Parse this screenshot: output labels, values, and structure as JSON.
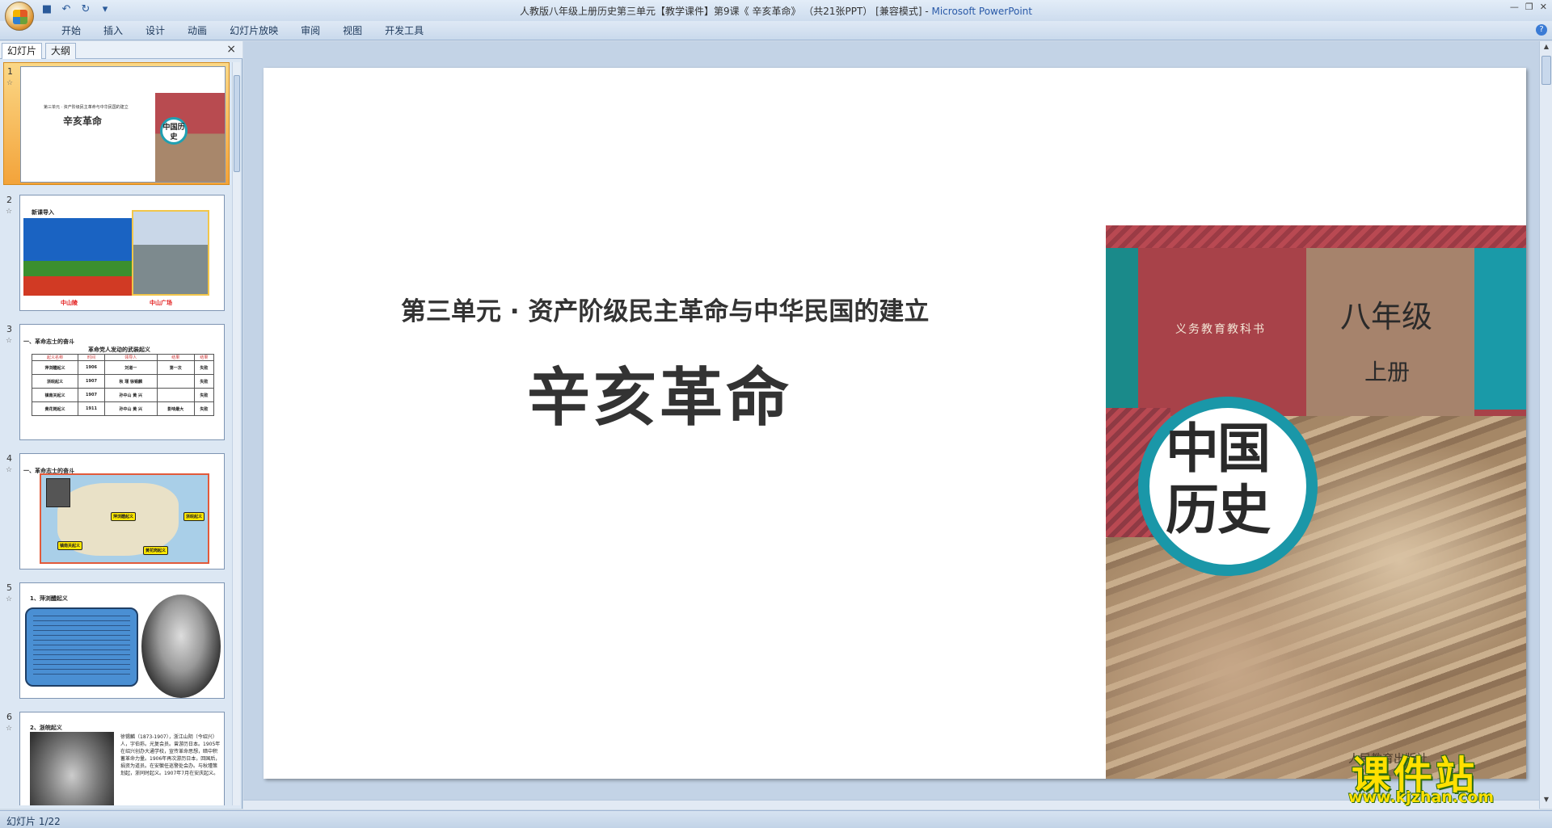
{
  "window": {
    "title_doc": "人教版八年级上册历史第三单元【教学课件】第9课《 辛亥革命》 （共21张PPT） [兼容模式] - ",
    "title_app": "Microsoft PowerPoint"
  },
  "ribbon": {
    "tabs": [
      "开始",
      "插入",
      "设计",
      "动画",
      "幻灯片放映",
      "审阅",
      "视图",
      "开发工具"
    ]
  },
  "pane": {
    "tab_slides": "幻灯片",
    "tab_outline": "大纲",
    "close": "×"
  },
  "thumbnails": [
    {
      "num": "1",
      "subtitle": "第三单元 · 资产阶级民主革命与中华民国的建立",
      "title": "辛亥革命",
      "cover_text": "中国历史",
      "cover_grade": "八年级"
    },
    {
      "num": "2",
      "heading": "新课导入",
      "caption_left": "中山陵",
      "caption_right": "中山广场"
    },
    {
      "num": "3",
      "heading": "一、革命志士的奋斗",
      "table_title": "革命党人发动的武装起义",
      "table_header": [
        "起义名称",
        "时间",
        "领导人",
        "结果",
        "结果"
      ],
      "rows": [
        [
          "萍浏醴起义",
          "1906",
          "刘道一",
          "第一次",
          "失败"
        ],
        [
          "浙皖起义",
          "1907",
          "秋 瑾 徐锡麟",
          "",
          "失败"
        ],
        [
          "镇南关起义",
          "1907",
          "孙中山 黄 兴",
          "",
          "失败"
        ],
        [
          "黄花岗起义",
          "1911",
          "孙中山 黄 兴",
          "影响最大",
          "失败"
        ]
      ]
    },
    {
      "num": "4",
      "heading": "一、革命志士的奋斗",
      "labels": [
        "萍浏醴起义",
        "浙皖起义",
        "镇南关起义",
        "黄花岗起义"
      ]
    },
    {
      "num": "5",
      "heading": "1、萍浏醴起义",
      "box_text": "刘道一（1884－1906），湖南湘潭人，同盟会会员……"
    },
    {
      "num": "6",
      "heading": "2、浙皖起义",
      "body": "徐锡麟（1873-1907），浙江山阴（今绍兴）人，字伯荪。光复会员。曾游历日本。1905年在绍兴创办大通学校，宣传革命思想，暗中积蓄革命力量。1906年再次游历日本，回国后，捐资为道员。在安徽任巡警处会办。与秋瑾策划起，浙同时起义。1907年7月在安庆起义。"
    }
  ],
  "slide": {
    "unit_title": "第三单元 · 资产阶级民主革命与中华民国的建立",
    "lesson_title": "辛亥革命",
    "cover": {
      "publisher_line": "义务教育教科书",
      "grade": "八年级",
      "volume": "上册",
      "circle_text": "中国历史",
      "press": "人民教育出版社"
    }
  },
  "watermark": {
    "text": "课件站",
    "url": "www.kjzhan.com"
  },
  "status": {
    "slide_indicator": "幻灯片 1/22"
  }
}
